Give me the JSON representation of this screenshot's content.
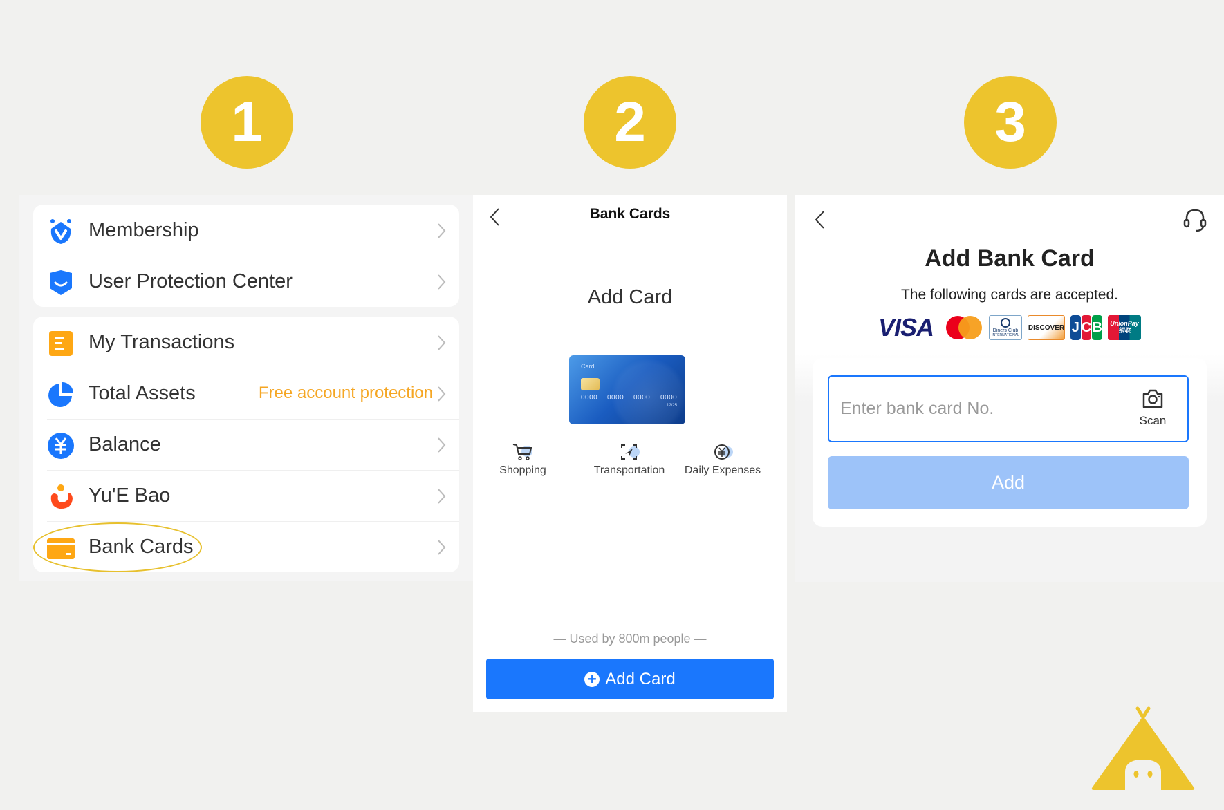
{
  "steps": [
    "1",
    "2",
    "3"
  ],
  "colors": {
    "step_yellow": "#edc42d",
    "primary_blue": "#1a77fd",
    "disabled_blue": "#9dc3f9",
    "accent_orange": "#f5a623",
    "background": "#f1f1ef"
  },
  "panel1": {
    "group1": [
      {
        "label": "Membership",
        "icon": "membership-icon"
      },
      {
        "label": "User Protection Center",
        "icon": "shield-icon"
      }
    ],
    "group2": [
      {
        "label": "My Transactions",
        "icon": "transactions-icon"
      },
      {
        "label": "Total Assets",
        "icon": "pie-chart-icon",
        "note": "Free account protection"
      },
      {
        "label": "Balance",
        "icon": "yuan-icon"
      },
      {
        "label": "Yu'E Bao",
        "icon": "yuebao-icon"
      },
      {
        "label": "Bank Cards",
        "icon": "bank-card-icon",
        "highlighted": true
      }
    ]
  },
  "panel2": {
    "nav_title": "Bank Cards",
    "hero_title": "Add Card",
    "card_preview": {
      "label": "Card",
      "numbers": [
        "0000",
        "0000",
        "0000",
        "0000"
      ],
      "expiry": "12/25"
    },
    "features": [
      {
        "label": "Shopping",
        "icon": "cart-icon"
      },
      {
        "label": "Transportation",
        "icon": "transport-icon"
      },
      {
        "label": "Daily Expenses",
        "icon": "yuan-coin-icon"
      }
    ],
    "used_by": "— Used by 800m people —",
    "add_button": "Add Card"
  },
  "panel3": {
    "title": "Add Bank Card",
    "subtitle": "The following cards are accepted.",
    "brands": [
      "VISA",
      "Mastercard",
      "Diners Club",
      "DISCOVER",
      "JCB",
      "UnionPay"
    ],
    "diners_text": [
      "Diners Club",
      "INTERNATIONAL"
    ],
    "discover_text": "DISCOVER",
    "jcb_letters": [
      "J",
      "C",
      "B"
    ],
    "unionpay_text": [
      "UnionPay",
      "银联"
    ],
    "input_placeholder": "Enter bank card No.",
    "scan_label": "Scan",
    "add_button": "Add"
  }
}
